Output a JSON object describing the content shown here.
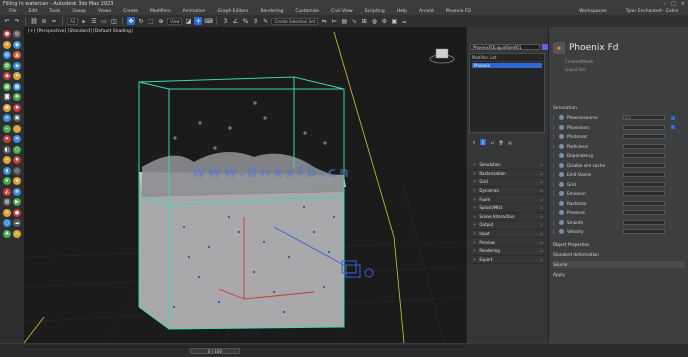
{
  "window": {
    "title": "Filling In watercan - Autodesk 3ds Max 2023",
    "controls": [
      "–",
      "□",
      "×"
    ]
  },
  "menubar": {
    "items": [
      "File",
      "Edit",
      "Tools",
      "Group",
      "Views",
      "Create",
      "Modifiers",
      "Animation",
      "Graph Editors",
      "Rendering",
      "Customize",
      "Civil View",
      "Scripting",
      "Help",
      "Arnold",
      "Phoenix FD"
    ],
    "right": [
      "Workspaces:",
      "Tyler Enchanted - Extra"
    ]
  },
  "toolbar": {
    "filter_label": "All",
    "view_label": "View",
    "selection_set": "Create Selection Set"
  },
  "viewport": {
    "label": "[+] [Perspective] [Standard] [Default Shading]",
    "watermark": "www.dnxxfb.cn"
  },
  "timeline": {
    "frame": "0 / 100"
  },
  "command_panel": {
    "object_name": "PhoenixFDLiquidSim001",
    "modifier_list_label": "Modifier List",
    "stack_item": "Phoenix",
    "rollouts": [
      "Simulation",
      "Rasterization",
      "Grid",
      "Dynamics",
      "Foam",
      "Splash/Mist",
      "Scene Interaction",
      "Output",
      "Input",
      "Preview",
      "Rendering",
      "Export"
    ]
  },
  "phoenix_panel": {
    "title": "Phoenix Fd",
    "sub1": "Created/Made",
    "sub2": "Liquid Sim",
    "section": "Simulation",
    "params": [
      {
        "label": "Phoenixsource",
        "value": "0.0"
      },
      {
        "label": "Phoenixsrc",
        "value": ""
      },
      {
        "label": "Photonsrc",
        "value": ""
      },
      {
        "label": "Particlesrc",
        "value": ""
      },
      {
        "label": "Dependency",
        "value": ""
      },
      {
        "label": "Disable sim cache",
        "value": ""
      },
      {
        "label": "Emit Voxels",
        "value": ""
      },
      {
        "label": "Grid",
        "value": ""
      },
      {
        "label": "Emission",
        "value": ""
      },
      {
        "label": "Rasterize",
        "value": ""
      },
      {
        "label": "Pressure",
        "value": ""
      },
      {
        "label": "Smooth",
        "value": ""
      },
      {
        "label": "Velocity",
        "value": ""
      }
    ],
    "bottom_section": "Object Properties",
    "bottom_rows": [
      "Standard deformation",
      "Source",
      "Apply"
    ]
  }
}
